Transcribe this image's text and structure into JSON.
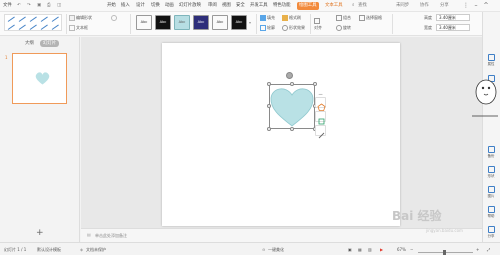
{
  "menubar": {
    "file": "文件",
    "items": [
      "开始",
      "插入",
      "设计",
      "切换",
      "动画",
      "幻灯片放映",
      "审阅",
      "视图",
      "安全",
      "开发工具",
      "特色功能",
      "绘图工具",
      "文本工具"
    ],
    "active_index": 11,
    "search": "查找",
    "sync": "未同步",
    "collab": "协作",
    "share": "分享"
  },
  "ribbon": {
    "fill_label": "填充",
    "outline_label": "轮廓",
    "format_brush": "格式刷",
    "shape_effect": "形状效果",
    "arrange_label": "对齐",
    "group_label": "组合",
    "rotate_label": "旋转",
    "select_label": "选择窗格",
    "edit_shape": "编辑形状",
    "text_box": "文本框",
    "height_label": "高度",
    "width_label": "宽度",
    "height_value": "3.40厘米",
    "width_value": "3.40厘米",
    "swatches": [
      {
        "text": "Abc",
        "bg": "#ffffff",
        "fg": "#333333"
      },
      {
        "text": "Abc",
        "bg": "#111111",
        "fg": "#ffffff"
      },
      {
        "text": "Abc",
        "bg": "#b7dee3",
        "fg": "#5a5a5a"
      },
      {
        "text": "Abc",
        "bg": "#2f2f7a",
        "fg": "#ffffff"
      },
      {
        "text": "Abc",
        "bg": "#ffffff",
        "fg": "#333333"
      },
      {
        "text": "Abc",
        "bg": "#111111",
        "fg": "#ffffff"
      }
    ]
  },
  "left_panel": {
    "tab_outline": "大纲",
    "tab_slides": "幻灯片",
    "slide_number": "1",
    "add_slide": "+"
  },
  "notes": {
    "placeholder": "单击此处添加备注"
  },
  "right_sidebar": {
    "items": [
      "属性",
      "动画",
      "备份",
      "形状",
      "图片",
      "帮助",
      "分享"
    ]
  },
  "statusbar": {
    "slide_info": "幻灯片 1 / 1",
    "theme": "默认设计模板",
    "doc_protect": "文档未保护",
    "remark": "一键美化",
    "zoom": "67%"
  },
  "watermark": {
    "brand": "Bai 经验",
    "url": "jingyan.baidu.com"
  },
  "colors": {
    "heart_fill": "#b9e1e5",
    "accent": "#f28a3c",
    "slide_border": "#f09a59"
  }
}
